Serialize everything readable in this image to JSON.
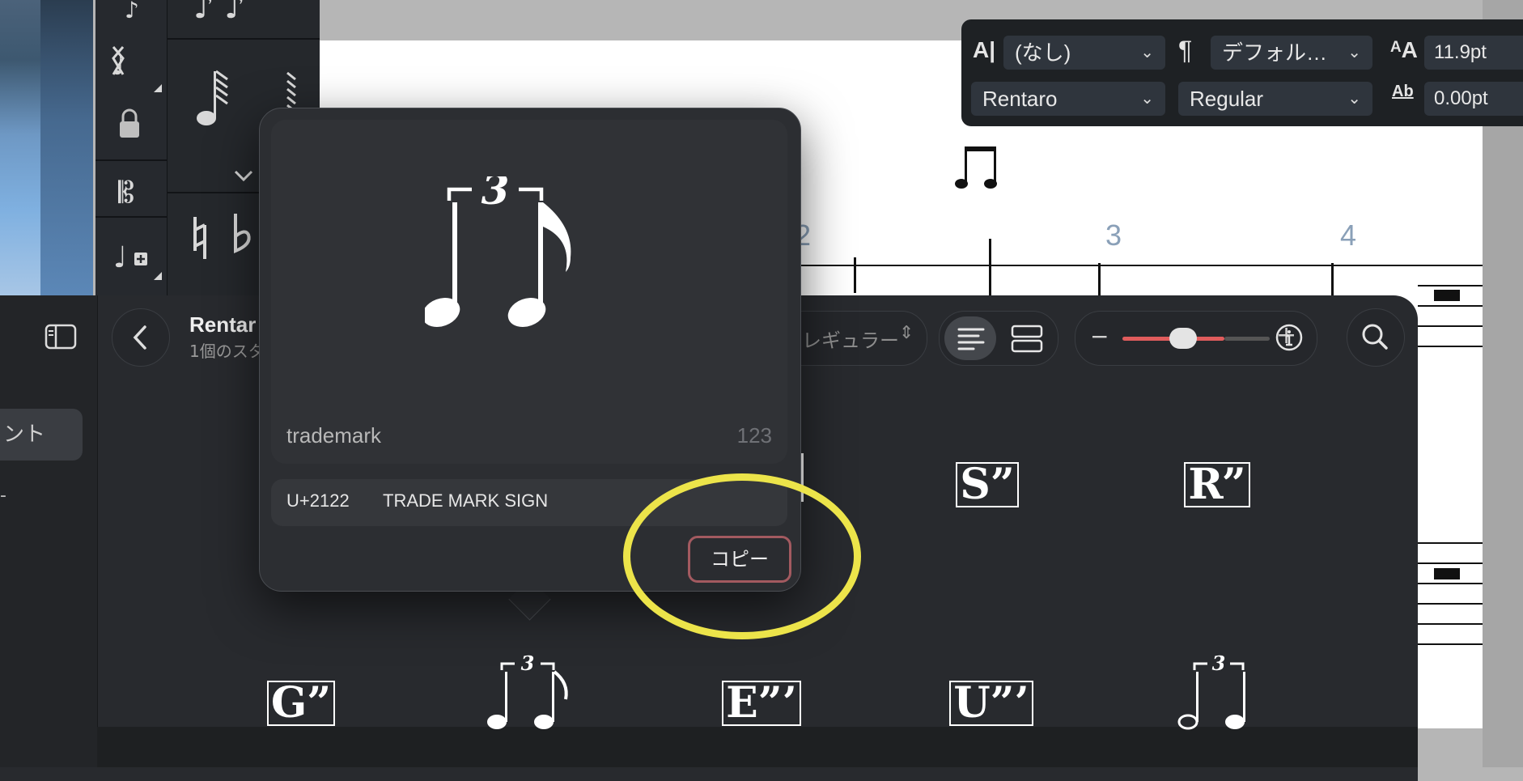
{
  "text_inspector": {
    "char_style": "(なし)",
    "para_style": "デフォル…",
    "font_family": "Rentaro",
    "font_style": "Regular",
    "font_size": "11.9pt",
    "tracking": "0.00pt",
    "char_style_icon": "A|",
    "para_icon": "¶",
    "size_icon": "ᴬA",
    "tracking_icon": "Ab"
  },
  "score": {
    "measure_numbers": [
      "2",
      "3",
      "4"
    ]
  },
  "glyph_browser": {
    "font_title": "Rentar",
    "font_subtitle": "1個のスタ",
    "style_selector": "レギュラー",
    "sidebar_selected_label": "ント",
    "colors": {
      "accent": "#e05c5c",
      "highlight": "#ece44a"
    }
  },
  "popover": {
    "glyph_name": "trademark",
    "glyph_index": "123",
    "codepoint": "U+2122",
    "unicode_name": "TRADE MARK SIGN",
    "copy_label": "コピー",
    "tuplet_number": "3"
  },
  "glyph_grid": {
    "row1": [
      "S”",
      "R”"
    ],
    "row2": [
      "G”",
      "E”’",
      "U”’"
    ],
    "tuplet_number": "3"
  },
  "icons": [
    "sidebar-toggle-icon",
    "back-chevron-icon",
    "align-left-icon",
    "rows-icon",
    "minus-icon",
    "plus-icon",
    "info-icon",
    "search-icon",
    "lock-icon",
    "clef-icon",
    "add-note-icon",
    "natural-icon",
    "flat-icon"
  ]
}
